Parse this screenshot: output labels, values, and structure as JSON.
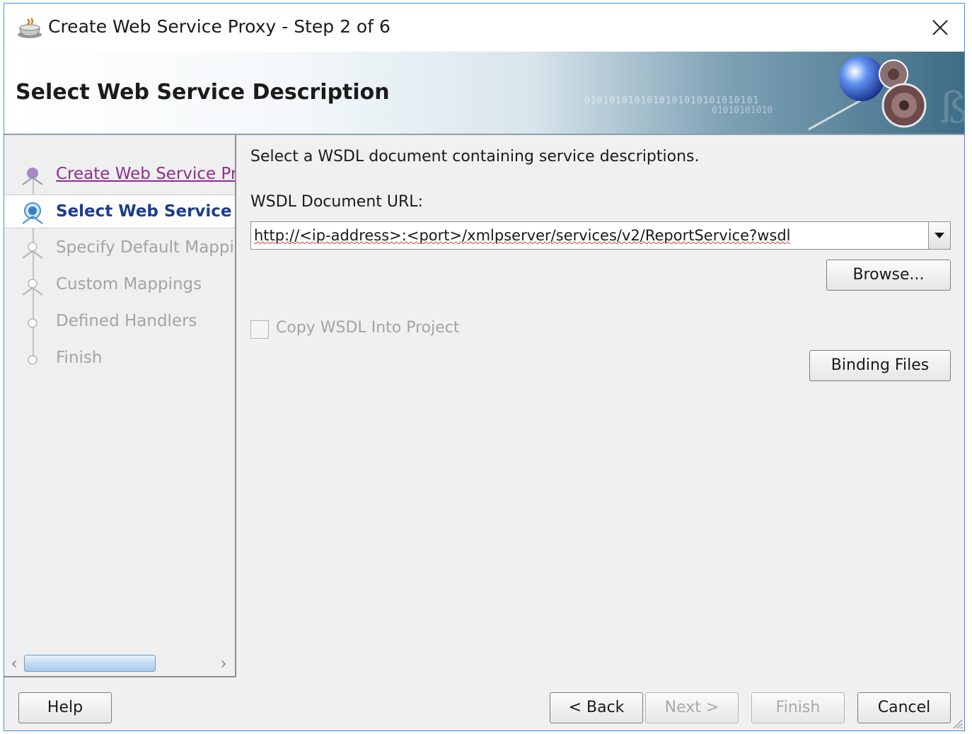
{
  "window": {
    "title": "Create Web Service Proxy - Step 2 of 6",
    "icon": "coffee-cup-icon"
  },
  "banner": {
    "title": "Select Web Service Description",
    "binary_text_1": "0101010101010101010101010101",
    "binary_text_2": "01010101010"
  },
  "steps": [
    {
      "label": "Create Web Service Pro",
      "state": "visited"
    },
    {
      "label": "Select Web Service D",
      "state": "current"
    },
    {
      "label": "Specify Default Mapping",
      "state": "disabled"
    },
    {
      "label": "Custom Mappings",
      "state": "disabled"
    },
    {
      "label": "Defined Handlers",
      "state": "disabled"
    },
    {
      "label": "Finish",
      "state": "disabled"
    }
  ],
  "main": {
    "description": "Select a WSDL document containing service descriptions.",
    "url_label": "WSDL Document URL:",
    "url_value": "http://<ip-address>:<port>/xmlpserver/services/v2/ReportService?wsdl",
    "browse_label": "Browse...",
    "copy_wsdl_label": "Copy WSDL Into Project",
    "copy_wsdl_checked": false,
    "binding_files_label": "Binding Files"
  },
  "footer": {
    "help_label": "Help",
    "back_label": "< Back",
    "next_label": "Next >",
    "finish_label": "Finish",
    "cancel_label": "Cancel"
  },
  "colors": {
    "accent_border": "#3f8edb",
    "visited_step": "#8f2d8f",
    "current_step": "#1b3d8f",
    "disabled_text": "#a4a4a4"
  }
}
